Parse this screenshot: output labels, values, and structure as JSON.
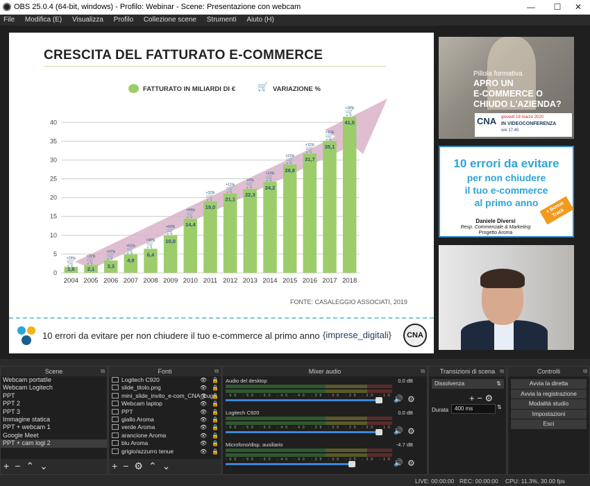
{
  "window": {
    "title": "OBS 25.0.4 (64-bit, windows) - Profilo: Webinar - Scene: Presentazione con webcam",
    "minimize": "—",
    "maximize": "☐",
    "close": "✕"
  },
  "menu": [
    "File",
    "Modifica (E)",
    "Visualizza",
    "Profilo",
    "Collezione scene",
    "Strumenti",
    "Aiuto (H)"
  ],
  "slide": {
    "title": "CRESCITA DEL FATTURATO E-COMMERCE",
    "legend_revenue": "FATTURATO IN MILIARDI DI €",
    "legend_variation": "VARIAZIONE %",
    "source": "FONTE: CASALEGGIO ASSOCIATI, 2019",
    "footer": "10 errori da evitare per non chiudere il tuo e-commerce al primo anno",
    "brand_left": "{",
    "brand_mid": "imprese_digitali",
    "brand_right": "}",
    "cna": "CNA"
  },
  "chart_data": {
    "type": "bar",
    "title": "CRESCITA DEL FATTURATO E-COMMERCE",
    "categories": [
      "2004",
      "2005",
      "2006",
      "2007",
      "2008",
      "2009",
      "2010",
      "2011",
      "2012",
      "2013",
      "2014",
      "2015",
      "2016",
      "2017",
      "2018"
    ],
    "series": [
      {
        "name": "FATTURATO IN MILIARDI DI €",
        "values": [
          1.6,
          2.1,
          3.3,
          4.9,
          6.4,
          10.0,
          14.4,
          19.0,
          21.1,
          22.3,
          24.2,
          28.8,
          31.7,
          35.1,
          41.5
        ]
      },
      {
        "name": "VARIAZIONE %",
        "values": [
          "+29%",
          "+31%",
          "+57%",
          "+51%",
          "+30%",
          "+63%",
          "+44%",
          "+32%",
          "+11%",
          "+6%",
          "+13%",
          "+21%",
          "+11%",
          "+11%",
          "+18%"
        ]
      }
    ],
    "value_labels": [
      "1,6",
      "2,1",
      "3,3",
      "4,9",
      "6,4",
      "10,0",
      "14,4",
      "19,0",
      "21,1",
      "22,3",
      "24,2",
      "28,8",
      "31,7",
      "35,1",
      "41,5"
    ],
    "yticks": [
      "0",
      "5",
      "10",
      "15",
      "20",
      "25",
      "30",
      "35",
      "40"
    ],
    "ylim": [
      0,
      43
    ],
    "colors": {
      "bar": "#9ccd6a",
      "cart": "#2c4e78",
      "arrow": "#d9b3c9"
    }
  },
  "promo1": {
    "subtitle": "Pillola formativa",
    "headline1": "APRO UN",
    "headline2": "E-COMMERCE O",
    "headline3": "CHIUDO L'AZIENDA?",
    "logo": "CNA",
    "date": "giovedì 19 marzo 2020",
    "mode": "IN VIDEOCONFERENZA",
    "time": "ore 17.45"
  },
  "promo2": {
    "line1": "10 errori da evitare",
    "line2": "per non chiudere",
    "line3": "il tuo e-commerce",
    "line4": "al primo anno",
    "name": "Daniele Diversi",
    "role": "Resp. Commerciale & Marketing",
    "org": "Progetto Aroma",
    "badge": "+ Bonus Track"
  },
  "docks": {
    "scenes": {
      "title": "Scene",
      "items": [
        "Webcam portatile",
        "Webcam Logitech",
        "PPT",
        "PPT 2",
        "PPT 3",
        "Immagine statica",
        "PPT + webcam 1",
        "Google Meet",
        "PPT + cam logi 2"
      ],
      "selected": 8
    },
    "sources": {
      "title": "Fonti",
      "items": [
        "Logitech C920",
        "slide_titolo.png",
        "mini_slide_invito_e-com_CNA_Lugo",
        "Webcam laptop",
        "PPT",
        "giallo Aroma",
        "verde Aroma",
        "arancione Aroma",
        "blu Aroma",
        "grigio/azzurro tenue"
      ]
    },
    "mixer": {
      "title": "Mixer audio",
      "channels": [
        {
          "name": "Audio del desktop",
          "db": "0.0 dB",
          "level": 0.95
        },
        {
          "name": "Logitech C920",
          "db": "0.0 dB",
          "level": 0.95
        },
        {
          "name": "Microfono/disp. ausiliario",
          "db": "-4.7 dB",
          "level": 0.78
        }
      ],
      "ticks": "-60 -55 -50 -45 -40 -35 -30 -25 -20 -15 -10 -5 0"
    },
    "transitions": {
      "title": "Transizioni di scena",
      "selected": "Dissolvenza",
      "duration_label": "Durata",
      "duration": "400 ms"
    },
    "controls": {
      "title": "Controlli",
      "buttons": [
        "Avvia la diretta",
        "Avvia la registrazione",
        "Modalità studio",
        "Impostazioni",
        "Esci"
      ]
    }
  },
  "status": {
    "live": "LIVE: 00:00:00",
    "rec": "REC: 00:00:00",
    "cpu": "CPU: 11.3%, 30.00 fps"
  }
}
